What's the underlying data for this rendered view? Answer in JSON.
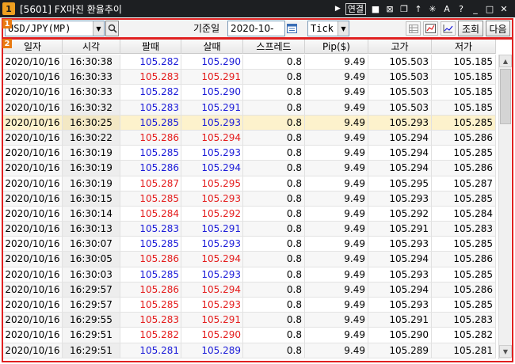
{
  "window": {
    "badge": "1",
    "title": "[5601] FX마진 환율추이",
    "link_label": "연결"
  },
  "annotations": {
    "toolbar_tag": "1",
    "grid_tag": "2"
  },
  "toolbar": {
    "symbol_value": "USD/JPY(MP)",
    "date_label": "기준일",
    "date_value": "2020-10-16",
    "interval_value": "Tick",
    "query_button": "조회",
    "next_button": "다음"
  },
  "grid": {
    "headers": [
      "일자",
      "시각",
      "팔때",
      "살때",
      "스프레드",
      "Pip($)",
      "고가",
      "저가"
    ],
    "rows": [
      {
        "date": "2020/10/16",
        "time": "16:30:38",
        "sell": "105.282",
        "buy": "105.290",
        "spread": "0.8",
        "pip": "9.49",
        "high": "105.503",
        "low": "105.185",
        "color": "blue"
      },
      {
        "date": "2020/10/16",
        "time": "16:30:33",
        "sell": "105.283",
        "buy": "105.291",
        "spread": "0.8",
        "pip": "9.49",
        "high": "105.503",
        "low": "105.185",
        "color": "red"
      },
      {
        "date": "2020/10/16",
        "time": "16:30:33",
        "sell": "105.282",
        "buy": "105.290",
        "spread": "0.8",
        "pip": "9.49",
        "high": "105.503",
        "low": "105.185",
        "color": "blue"
      },
      {
        "date": "2020/10/16",
        "time": "16:30:32",
        "sell": "105.283",
        "buy": "105.291",
        "spread": "0.8",
        "pip": "9.49",
        "high": "105.503",
        "low": "105.185",
        "color": "blue"
      },
      {
        "date": "2020/10/16",
        "time": "16:30:25",
        "sell": "105.285",
        "buy": "105.293",
        "spread": "0.8",
        "pip": "9.49",
        "high": "105.293",
        "low": "105.285",
        "color": "blue",
        "selected": true
      },
      {
        "date": "2020/10/16",
        "time": "16:30:22",
        "sell": "105.286",
        "buy": "105.294",
        "spread": "0.8",
        "pip": "9.49",
        "high": "105.294",
        "low": "105.286",
        "color": "red"
      },
      {
        "date": "2020/10/16",
        "time": "16:30:19",
        "sell": "105.285",
        "buy": "105.293",
        "spread": "0.8",
        "pip": "9.49",
        "high": "105.294",
        "low": "105.285",
        "color": "blue"
      },
      {
        "date": "2020/10/16",
        "time": "16:30:19",
        "sell": "105.286",
        "buy": "105.294",
        "spread": "0.8",
        "pip": "9.49",
        "high": "105.294",
        "low": "105.286",
        "color": "blue"
      },
      {
        "date": "2020/10/16",
        "time": "16:30:19",
        "sell": "105.287",
        "buy": "105.295",
        "spread": "0.8",
        "pip": "9.49",
        "high": "105.295",
        "low": "105.287",
        "color": "red"
      },
      {
        "date": "2020/10/16",
        "time": "16:30:15",
        "sell": "105.285",
        "buy": "105.293",
        "spread": "0.8",
        "pip": "9.49",
        "high": "105.293",
        "low": "105.285",
        "color": "red"
      },
      {
        "date": "2020/10/16",
        "time": "16:30:14",
        "sell": "105.284",
        "buy": "105.292",
        "spread": "0.8",
        "pip": "9.49",
        "high": "105.292",
        "low": "105.284",
        "color": "red"
      },
      {
        "date": "2020/10/16",
        "time": "16:30:13",
        "sell": "105.283",
        "buy": "105.291",
        "spread": "0.8",
        "pip": "9.49",
        "high": "105.291",
        "low": "105.283",
        "color": "blue"
      },
      {
        "date": "2020/10/16",
        "time": "16:30:07",
        "sell": "105.285",
        "buy": "105.293",
        "spread": "0.8",
        "pip": "9.49",
        "high": "105.293",
        "low": "105.285",
        "color": "blue"
      },
      {
        "date": "2020/10/16",
        "time": "16:30:05",
        "sell": "105.286",
        "buy": "105.294",
        "spread": "0.8",
        "pip": "9.49",
        "high": "105.294",
        "low": "105.286",
        "color": "red"
      },
      {
        "date": "2020/10/16",
        "time": "16:30:03",
        "sell": "105.285",
        "buy": "105.293",
        "spread": "0.8",
        "pip": "9.49",
        "high": "105.293",
        "low": "105.285",
        "color": "blue"
      },
      {
        "date": "2020/10/16",
        "time": "16:29:57",
        "sell": "105.286",
        "buy": "105.294",
        "spread": "0.8",
        "pip": "9.49",
        "high": "105.294",
        "low": "105.286",
        "color": "red"
      },
      {
        "date": "2020/10/16",
        "time": "16:29:57",
        "sell": "105.285",
        "buy": "105.293",
        "spread": "0.8",
        "pip": "9.49",
        "high": "105.293",
        "low": "105.285",
        "color": "red"
      },
      {
        "date": "2020/10/16",
        "time": "16:29:55",
        "sell": "105.283",
        "buy": "105.291",
        "spread": "0.8",
        "pip": "9.49",
        "high": "105.291",
        "low": "105.283",
        "color": "red"
      },
      {
        "date": "2020/10/16",
        "time": "16:29:51",
        "sell": "105.282",
        "buy": "105.290",
        "spread": "0.8",
        "pip": "9.49",
        "high": "105.290",
        "low": "105.282",
        "color": "red"
      },
      {
        "date": "2020/10/16",
        "time": "16:29:51",
        "sell": "105.281",
        "buy": "105.289",
        "spread": "0.8",
        "pip": "9.49",
        "high": "105.289",
        "low": "105.281",
        "color": "blue"
      }
    ]
  },
  "colors": {
    "title_bar": "#1d1f22",
    "annotation_red": "#e02020",
    "annotation_tag": "#e87a12",
    "up_red": "#e41b1b",
    "down_blue": "#1a1ad8",
    "selected_row": "#fdf2cc"
  },
  "icons": [
    "arrow-right-icon",
    "lock-icon",
    "close-box-icon",
    "copy-icon",
    "pin-icon",
    "settings-icon",
    "font-icon",
    "help-icon",
    "minimize-icon",
    "maximize-icon",
    "close-icon",
    "search-icon",
    "calendar-icon",
    "table-view-icon",
    "chart-view-icon",
    "line-chart-icon"
  ]
}
